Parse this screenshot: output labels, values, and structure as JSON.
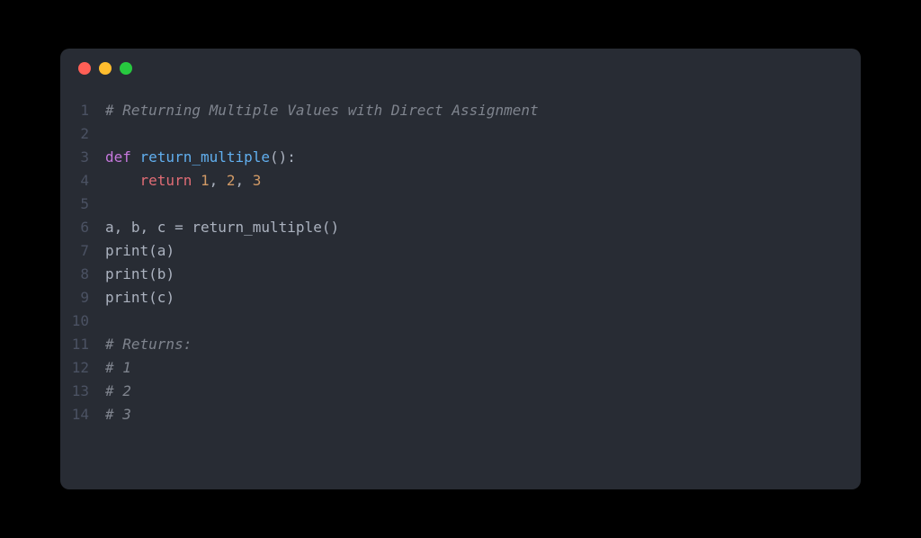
{
  "window": {
    "traffic_lights": [
      "close",
      "minimize",
      "maximize"
    ]
  },
  "code": {
    "language": "python",
    "lines": [
      {
        "n": 1,
        "tokens": [
          {
            "t": "# Returning Multiple Values with Direct Assignment",
            "c": "comment"
          }
        ]
      },
      {
        "n": 2,
        "tokens": []
      },
      {
        "n": 3,
        "tokens": [
          {
            "t": "def ",
            "c": "keyword"
          },
          {
            "t": "return_multiple",
            "c": "func"
          },
          {
            "t": "():",
            "c": "punct"
          }
        ]
      },
      {
        "n": 4,
        "tokens": [
          {
            "t": "    ",
            "c": "plain"
          },
          {
            "t": "return ",
            "c": "keyword2"
          },
          {
            "t": "1",
            "c": "number"
          },
          {
            "t": ", ",
            "c": "punct"
          },
          {
            "t": "2",
            "c": "number"
          },
          {
            "t": ", ",
            "c": "punct"
          },
          {
            "t": "3",
            "c": "number"
          }
        ]
      },
      {
        "n": 5,
        "tokens": []
      },
      {
        "n": 6,
        "tokens": [
          {
            "t": "a, b, c ",
            "c": "plain"
          },
          {
            "t": "=",
            "c": "punct"
          },
          {
            "t": " return_multiple()",
            "c": "plain"
          }
        ]
      },
      {
        "n": 7,
        "tokens": [
          {
            "t": "print",
            "c": "plain"
          },
          {
            "t": "(a)",
            "c": "plain"
          }
        ]
      },
      {
        "n": 8,
        "tokens": [
          {
            "t": "print",
            "c": "plain"
          },
          {
            "t": "(b)",
            "c": "plain"
          }
        ]
      },
      {
        "n": 9,
        "tokens": [
          {
            "t": "print",
            "c": "plain"
          },
          {
            "t": "(c)",
            "c": "plain"
          }
        ]
      },
      {
        "n": 10,
        "tokens": []
      },
      {
        "n": 11,
        "tokens": [
          {
            "t": "# Returns:",
            "c": "comment"
          }
        ]
      },
      {
        "n": 12,
        "tokens": [
          {
            "t": "# 1",
            "c": "comment"
          }
        ]
      },
      {
        "n": 13,
        "tokens": [
          {
            "t": "# 2",
            "c": "comment"
          }
        ]
      },
      {
        "n": 14,
        "tokens": [
          {
            "t": "# 3",
            "c": "comment"
          }
        ]
      }
    ]
  }
}
